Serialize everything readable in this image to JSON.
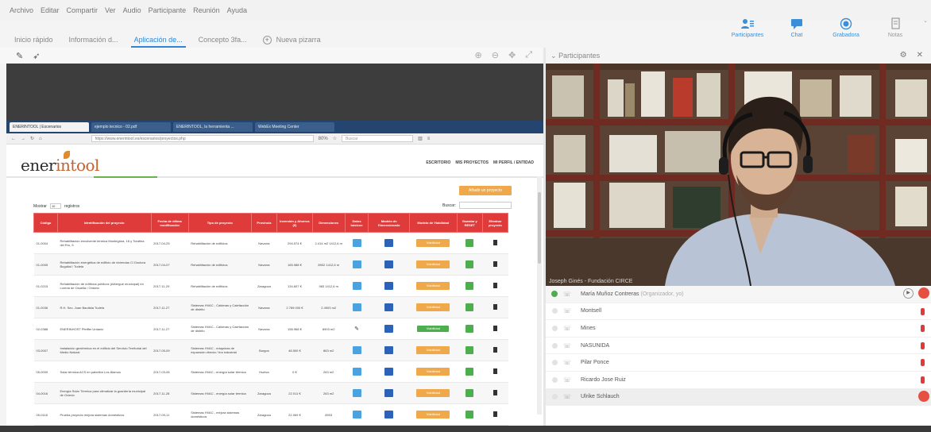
{
  "menu": [
    "Archivo",
    "Editar",
    "Compartir",
    "Ver",
    "Audio",
    "Participante",
    "Reunión",
    "Ayuda"
  ],
  "tabs": [
    {
      "label": "Inicio rápido",
      "active": false
    },
    {
      "label": "Información d...",
      "active": false
    },
    {
      "label": "Aplicación de...",
      "active": true
    },
    {
      "label": "Concepto 3fa...",
      "active": false
    }
  ],
  "new_tab_label": "Nueva pizarra",
  "top_right": [
    {
      "label": "Participantes",
      "icon": "participants-icon"
    },
    {
      "label": "Chat",
      "icon": "chat-icon"
    },
    {
      "label": "Grabadora",
      "icon": "record-icon"
    },
    {
      "label": "Notas",
      "icon": "notes-icon"
    }
  ],
  "participants_panel": {
    "header": "Participantes"
  },
  "browser": {
    "tabs": [
      "ENERINTOOL | Escenarios",
      "ejemplo tecnico - 02.pdf",
      "ENERINTOOL, la herramienta ...",
      "WebEx Meeting Center"
    ],
    "url": "https://www.enerintool.es/escenarios/proyectos.php",
    "zoom": "80%",
    "search_placeholder": "Buscar"
  },
  "site": {
    "logo_part1": "ener",
    "logo_part2": "intool",
    "nav": [
      "ESCRITORIO",
      "MIS PROYECTOS",
      "MI PERFIL / ENTIDAD"
    ],
    "add_button": "Añadir un proyecto",
    "show_label": "Mostrar",
    "show_value": "10",
    "registers_label": "registros",
    "search_label": "Buscar:"
  },
  "table": {
    "headers": [
      "Código",
      "Identificación del proyecto",
      "Fecha de última modificación",
      "Tipo de proyecto",
      "Provincia",
      "Inversión y Ahorros (€)",
      "Dimensiones",
      "Datos básicos",
      "Modelo de Dimensionado",
      "Modelo de Viabilidad",
      "Guardar y RESET",
      "Eliminar proyecto"
    ],
    "rows": [
      {
        "code": "01-0004",
        "name": "Rehabilitación envolvente térmica Montegrina, 16 y Torafina del Río, 5",
        "date": "2017-04-25",
        "type": "Rehabilitación de edificios",
        "prov": "Navarra",
        "inv": "294.574 €",
        "dim": "2.414 m2 1412,6 m",
        "mode": "orange",
        "pencil": false
      },
      {
        "code": "01-0005",
        "name": "Rehabilitación energética de edificio de viviendas C/ Doctora Bugallal / Tudela",
        "date": "2017-04-07",
        "type": "Rehabilitación de edificios",
        "prov": "Navarra",
        "inv": "165.988 €",
        "dim": "8902 1412,6 m",
        "mode": "orange",
        "pencil": false
      },
      {
        "code": "01-0215",
        "name": "Rehabilitación de edificios públicos (Albergue municipal) en Lorena de Osuella / Ontoria",
        "date": "2017-11-29",
        "type": "Rehabilitación de edificios",
        "prov": "Zaragoza",
        "inv": "134.607 €",
        "dim": "983 1412,6 m",
        "mode": "orange",
        "pencil": false
      },
      {
        "code": "01-0036",
        "name": "R.H. Sec. Juan Bautista Tudela",
        "date": "2017-11-27",
        "type": "Sistemas HVAC - Calderas y Calefacción de distrito",
        "prov": "Navarra",
        "inv": "2.789.000 €",
        "dim": "2.4903 m2",
        "mode": "orange",
        "pencil": false
      },
      {
        "code": "02-0388",
        "name": "ENERINHOST Pfeiffer Urdaniz",
        "date": "2017-11-27",
        "type": "Sistemas HVAC - Calderas y Calefacción de distrito",
        "prov": "Navarra",
        "inv": "158.968 €",
        "dim": "8903 m2",
        "mode": "green",
        "pencil": true
      },
      {
        "code": "03-0007",
        "name": "Instalación geotérmica en el edificio del Servicio Territorial del Medio Natural",
        "date": "2017-05-09",
        "type": "Sistemas HVAC - máquinas de expansión directa / fría industrial",
        "prov": "Burgos",
        "inv": "48.500 €",
        "dim": "863 m2",
        "mode": "orange",
        "pencil": false
      },
      {
        "code": "05-0009",
        "name": "Solar térmica ACS en pabellón Los Álamos",
        "date": "2017-03-06",
        "type": "Sistemas HVAC - energía solar térmica",
        "prov": "Huelva",
        "inv": "0 €",
        "dim": "263 m2",
        "mode": "orange",
        "pencil": false
      },
      {
        "code": "04-0016",
        "name": "Energía Solar Térmica para climatizar la guardería municipal de Oviedo",
        "date": "2017-11-28",
        "type": "Sistemas HVAC - energía solar térmica",
        "prov": "Zaragoza",
        "inv": "22.011 €",
        "dim": "263 m2",
        "mode": "orange",
        "pencil": false
      },
      {
        "code": "05-0118",
        "name": "Prueba proyecto mejora sistemas domésticos",
        "date": "2017-09-11",
        "type": "Sistemas HVAC - mejora sistemas domésticos",
        "prov": "Zaragoza",
        "inv": "22.069 €",
        "dim": "8903",
        "mode": "orange",
        "pencil": false
      }
    ],
    "orange_label": "Viabilidad",
    "green_label": "Viabilidad"
  },
  "video": {
    "caption": "Joseph Ginés - Fundación CIRCE"
  },
  "participants": [
    {
      "name": "María Muñoz Contreras",
      "org": "(Organizador, yo)",
      "first": true
    },
    {
      "name": "Montsell",
      "org": ""
    },
    {
      "name": "Mines",
      "org": ""
    },
    {
      "name": "NASUNIDA",
      "org": ""
    },
    {
      "name": "Pilar Ponce",
      "org": ""
    },
    {
      "name": "Ricardo Jose Ruiz",
      "org": ""
    },
    {
      "name": "Ulrike Schlauch",
      "org": "",
      "last": true
    }
  ],
  "colors": {
    "accent": "#2f86d6",
    "table_header": "#e03b3b",
    "orange": "#f0a94a",
    "green": "#4cae4c"
  }
}
